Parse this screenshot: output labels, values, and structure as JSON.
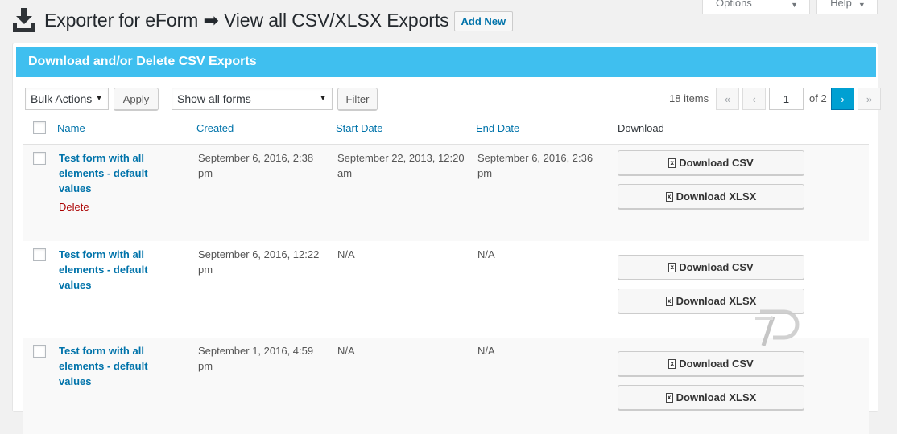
{
  "screen_meta": {
    "options": "Screen Options",
    "help": "Help",
    "caret": "▼"
  },
  "header": {
    "title": "Exporter for eForm ➡ View all CSV/XLSX Exports",
    "add_new": "Add New"
  },
  "panel": {
    "title": "Download and/or Delete CSV Exports"
  },
  "toolbar": {
    "bulk_actions": "Bulk Actions",
    "apply": "Apply",
    "forms_filter": "Show all forms",
    "filter": "Filter",
    "items_count": "18 items",
    "first": "«",
    "prev": "‹",
    "current_page": "1",
    "of_total": "of 2",
    "next": "›",
    "last": "»"
  },
  "table": {
    "columns": {
      "name": "Name",
      "created": "Created",
      "start_date": "Start Date",
      "end_date": "End Date",
      "download": "Download"
    },
    "rows": [
      {
        "name": "Test form with all elements - default values",
        "created": "September 6, 2016, 2:38 pm",
        "start_date": "September 22, 2013, 12:20 am",
        "end_date": "September 6, 2016, 2:36 pm",
        "delete": "Delete",
        "csv": "Download CSV",
        "xlsx": "Download XLSX"
      },
      {
        "name": "Test form with all elements - default values",
        "created": "September 6, 2016, 12:22 pm",
        "start_date": "N/A",
        "end_date": "N/A",
        "csv": "Download CSV",
        "xlsx": "Download XLSX"
      },
      {
        "name": "Test form with all elements - default values",
        "created": "September 1, 2016, 4:59 pm",
        "start_date": "N/A",
        "end_date": "N/A",
        "csv": "Download CSV",
        "xlsx": "Download XLSX"
      }
    ]
  },
  "file_icon_glyph": "x",
  "colors": {
    "accent": "#3fbfef",
    "link": "#0073aa",
    "delete": "#aa0000",
    "pager_active": "#00a0d2"
  }
}
